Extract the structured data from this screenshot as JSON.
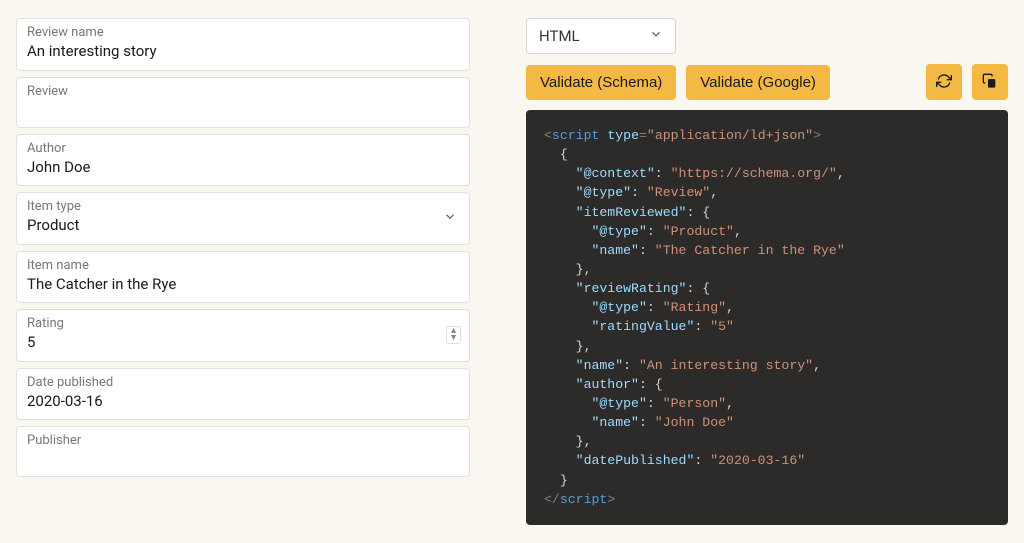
{
  "fields": {
    "review_name": {
      "label": "Review name",
      "value": "An interesting story"
    },
    "review": {
      "label": "Review",
      "value": ""
    },
    "author": {
      "label": "Author",
      "value": "John Doe"
    },
    "item_type": {
      "label": "Item type",
      "value": "Product"
    },
    "item_name": {
      "label": "Item name",
      "value": "The Catcher in the Rye"
    },
    "rating": {
      "label": "Rating",
      "value": "5"
    },
    "date_published": {
      "label": "Date published",
      "value": "2020-03-16"
    },
    "publisher": {
      "label": "Publisher",
      "value": ""
    }
  },
  "output_format": "HTML",
  "buttons": {
    "validate_schema": "Validate (Schema)",
    "validate_google": "Validate (Google)"
  },
  "code": {
    "script_open_1": "<",
    "script_elem": "script",
    "type_attr": "type",
    "type_val": "\"application/ld+json\"",
    "close_angle": ">",
    "brace_open": "{",
    "context_key": "\"@context\"",
    "context_val": "\"https://schema.org/\"",
    "type_key": "\"@type\"",
    "review_val": "\"Review\"",
    "itemReviewed_key": "\"itemReviewed\"",
    "product_val": "\"Product\"",
    "name_key": "\"name\"",
    "item_name_val": "\"The Catcher in the Rye\"",
    "reviewRating_key": "\"reviewRating\"",
    "rating_val_type": "\"Rating\"",
    "ratingValue_key": "\"ratingValue\"",
    "ratingValue_val": "\"5\"",
    "review_name_val": "\"An interesting story\"",
    "author_key": "\"author\"",
    "person_val": "\"Person\"",
    "author_name_val": "\"John Doe\"",
    "datePublished_key": "\"datePublished\"",
    "datePublished_val": "\"2020-03-16\"",
    "brace_close": "}",
    "script_close": "</",
    "colon_sp": ": ",
    "comma": ","
  }
}
